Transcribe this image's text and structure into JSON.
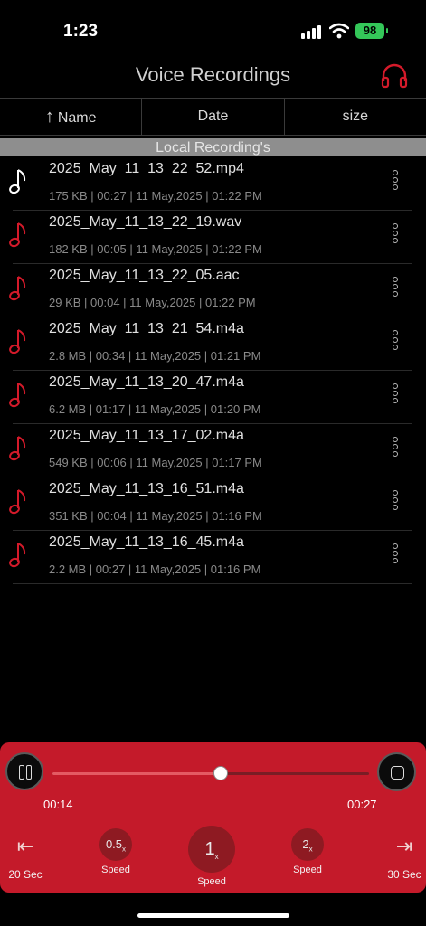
{
  "status": {
    "time": "1:23",
    "battery": "98"
  },
  "header": {
    "title": "Voice Recordings",
    "icon": "headphones-icon"
  },
  "sort": {
    "name": "Name",
    "date": "Date",
    "size": "size"
  },
  "section": "Local Recording's",
  "recordings": [
    {
      "name": "2025_May_11_13_22_52.mp4",
      "meta": "175 KB | 00:27 | 11 May,2025 | 01:22 PM",
      "icon_color": "#ffffff"
    },
    {
      "name": "2025_May_11_13_22_19.wav",
      "meta": "182 KB | 00:05 | 11 May,2025 | 01:22 PM",
      "icon_color": "#d41a2a"
    },
    {
      "name": "2025_May_11_13_22_05.aac",
      "meta": "29 KB | 00:04 | 11 May,2025 | 01:22 PM",
      "icon_color": "#d41a2a"
    },
    {
      "name": "2025_May_11_13_21_54.m4a",
      "meta": "2.8 MB | 00:34 | 11 May,2025 | 01:21 PM",
      "icon_color": "#d41a2a"
    },
    {
      "name": "2025_May_11_13_20_47.m4a",
      "meta": "6.2 MB | 01:17 | 11 May,2025 | 01:20 PM",
      "icon_color": "#d41a2a"
    },
    {
      "name": "2025_May_11_13_17_02.m4a",
      "meta": "549 KB | 00:06 | 11 May,2025 | 01:17 PM",
      "icon_color": "#d41a2a"
    },
    {
      "name": "2025_May_11_13_16_51.m4a",
      "meta": "351 KB | 00:04 | 11 May,2025 | 01:16 PM",
      "icon_color": "#d41a2a"
    },
    {
      "name": "2025_May_11_13_16_45.m4a",
      "meta": "2.2 MB | 00:27 | 11 May,2025 | 01:16 PM",
      "icon_color": "#d41a2a"
    }
  ],
  "player": {
    "current": "00:14",
    "total": "00:27",
    "progress": 0.53,
    "rewind_label": "20 Sec",
    "forward_label": "30 Sec",
    "speed_slow": "0.5",
    "speed_normal": "1",
    "speed_fast": "2",
    "speed_suffix": "x",
    "speed_label": "Speed",
    "accent": "#c41a2a"
  }
}
